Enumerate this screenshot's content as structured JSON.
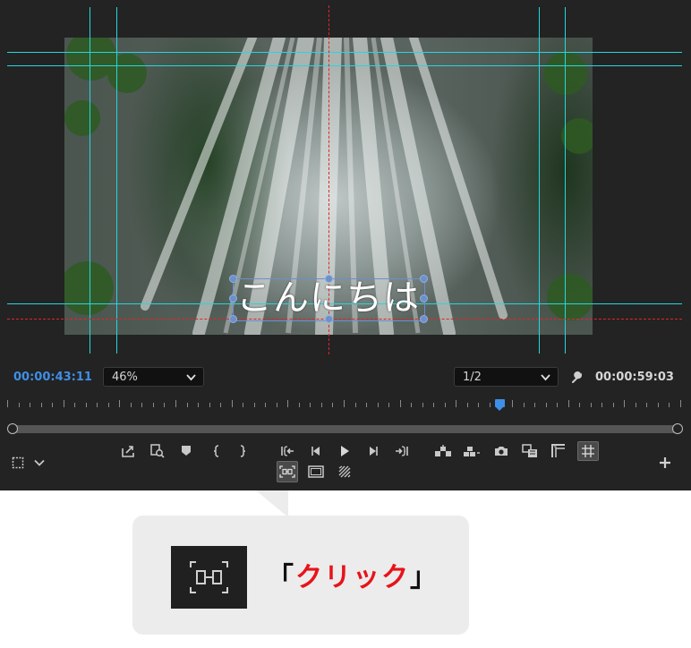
{
  "monitor": {
    "title_text": "こんにちは",
    "current_timecode": "00:00:43:11",
    "total_timecode": "00:00:59:03",
    "zoom": {
      "value": "46%"
    },
    "resolution": {
      "value": "1/2"
    },
    "playhead_fraction": 0.73
  },
  "controls": {
    "row1": [
      "export-frame-icon",
      "insert-icon",
      "marker-icon",
      "mark-in-icon",
      "mark-out-icon",
      "go-to-in-icon",
      "step-back-icon",
      "play-icon",
      "step-forward-icon",
      "go-to-out-icon",
      "lift-icon",
      "extract-icon",
      "camera-icon",
      "comparison-view-icon",
      "safe-margins-icon",
      "guides-icon"
    ],
    "row2": [
      "snap-guides-icon",
      "frame-icon",
      "transparency-icon"
    ]
  },
  "callout": {
    "open_bracket": "「",
    "text": "クリック",
    "close_bracket": "」",
    "accent_color": "#e8131a"
  },
  "colors": {
    "guides": "#22d8e0",
    "center_guides": "#e0242b",
    "timecode_blue": "#3d8fe8"
  }
}
